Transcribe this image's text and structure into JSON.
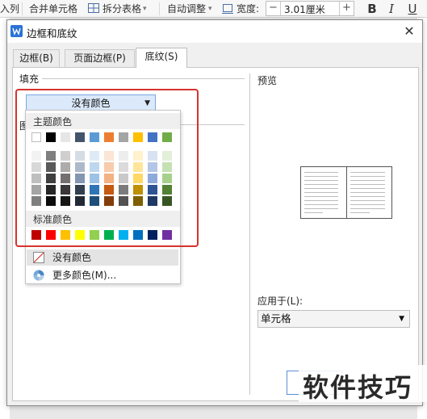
{
  "ribbon": {
    "cut_text": "入列",
    "merge_cells": "合并单元格",
    "split_table": "拆分表格",
    "auto_adjust": "自动调整",
    "width_label": "宽度:",
    "width_value": "3.01厘米",
    "minus": "−",
    "plus": "+",
    "bold": "B",
    "italic": "I",
    "underline": "U"
  },
  "dialog": {
    "title": "边框和底纹",
    "close": "✕",
    "tabs": [
      {
        "label": "边框(B)"
      },
      {
        "label": "页面边框(P)"
      },
      {
        "label": "底纹(S)"
      }
    ],
    "fill_label": "填充",
    "pattern_label_fragment": "图",
    "fill_select_value": "没有颜色",
    "preview_label": "预览",
    "apply_to_label": "应用于(L):",
    "apply_to_value": "单元格"
  },
  "color_popup": {
    "theme_colors_title": "主题颜色",
    "standard_colors_title": "标准颜色",
    "no_color": "没有颜色",
    "more_colors": "更多颜色(M)...",
    "theme_colors_top": [
      "#FFFFFF",
      "#000000",
      "#E7E6E6",
      "#44546A",
      "#5B9BD5",
      "#ED7D31",
      "#A5A5A5",
      "#FFC000",
      "#4472C4",
      "#70AD47"
    ],
    "theme_tints": [
      [
        "#F2F2F2",
        "#7F7F7F",
        "#D0CECE",
        "#D6DCE4",
        "#DEEBF6",
        "#FBE5D5",
        "#EDEDED",
        "#FFF2CC",
        "#D9E2F3",
        "#E2EFD9"
      ],
      [
        "#D8D8D8",
        "#595959",
        "#AEABAB",
        "#ADB9CA",
        "#BDD7EE",
        "#F7CBAC",
        "#DBDBDB",
        "#FEE599",
        "#B4C6E7",
        "#C5E0B3"
      ],
      [
        "#BFBFBF",
        "#3F3F3F",
        "#757070",
        "#8496B0",
        "#9CC3E5",
        "#F4B183",
        "#C9C9C9",
        "#FFD965",
        "#8EAADB",
        "#A8D08D"
      ],
      [
        "#A5A5A5",
        "#262626",
        "#3A3838",
        "#323F4F",
        "#2E75B5",
        "#C55A11",
        "#7B7B7B",
        "#BF9000",
        "#2F5496",
        "#538135"
      ],
      [
        "#7F7F7F",
        "#0C0C0C",
        "#171616",
        "#222A35",
        "#1E4E79",
        "#833C0B",
        "#525252",
        "#7F6000",
        "#1F3864",
        "#375623"
      ]
    ],
    "standard_colors": [
      "#C00000",
      "#FF0000",
      "#FFC000",
      "#FFFF00",
      "#92D050",
      "#00B050",
      "#00B0F0",
      "#0070C0",
      "#002060",
      "#7030A0"
    ]
  },
  "watermark": "软件技巧",
  "colors": {
    "highlight_red": "#D8322C",
    "select_blue": "#DBE9FB"
  }
}
